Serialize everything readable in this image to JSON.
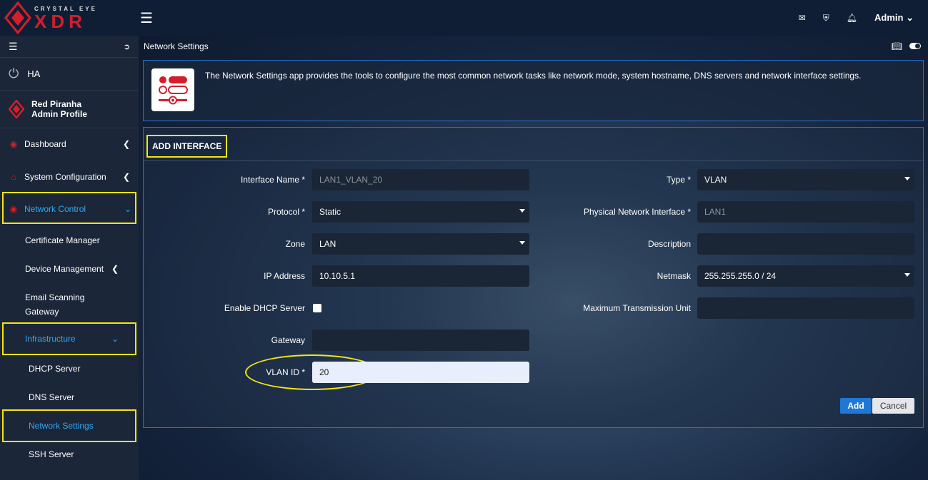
{
  "brand": {
    "top": "CRYSTAL EYE",
    "main": "XDR"
  },
  "header": {
    "admin_label": "Admin"
  },
  "sidebar": {
    "ha_label": "HA",
    "profile": {
      "name": "Red Piranha",
      "role": "Admin Profile"
    },
    "items": [
      {
        "label": "Dashboard"
      },
      {
        "label": "System Configuration"
      },
      {
        "label": "Network Control"
      },
      {
        "label": "Certificate Manager"
      },
      {
        "label": "Device Management"
      },
      {
        "label": "Email Scanning"
      },
      {
        "label": "Gateway"
      },
      {
        "label": "Infrastructure"
      },
      {
        "label": "DHCP Server"
      },
      {
        "label": "DNS Server"
      },
      {
        "label": "Network Settings"
      },
      {
        "label": "SSH Server"
      }
    ]
  },
  "main": {
    "title": "Network Settings",
    "info_text": "The Network Settings app provides the tools to configure the most common network tasks like network mode, system hostname, DNS servers and network interface settings.",
    "form": {
      "title": "ADD INTERFACE",
      "interface_name_label": "Interface Name *",
      "interface_name_value": "LAN1_VLAN_20",
      "protocol_label": "Protocol *",
      "protocol_value": "Static",
      "zone_label": "Zone",
      "zone_value": "LAN",
      "ip_label": "IP Address",
      "ip_value": "10.10.5.1",
      "dhcp_label": "Enable DHCP Server",
      "gateway_label": "Gateway",
      "gateway_value": "",
      "vlan_label": "VLAN ID *",
      "vlan_value": "20",
      "type_label": "Type *",
      "type_value": "VLAN",
      "phys_label": "Physical Network Interface *",
      "phys_value": "LAN1",
      "desc_label": "Description",
      "desc_value": "",
      "netmask_label": "Netmask",
      "netmask_value": "255.255.255.0 / 24",
      "mtu_label": "Maximum Transmission Unit",
      "mtu_value": "",
      "add_label": "Add",
      "cancel_label": "Cancel"
    }
  }
}
